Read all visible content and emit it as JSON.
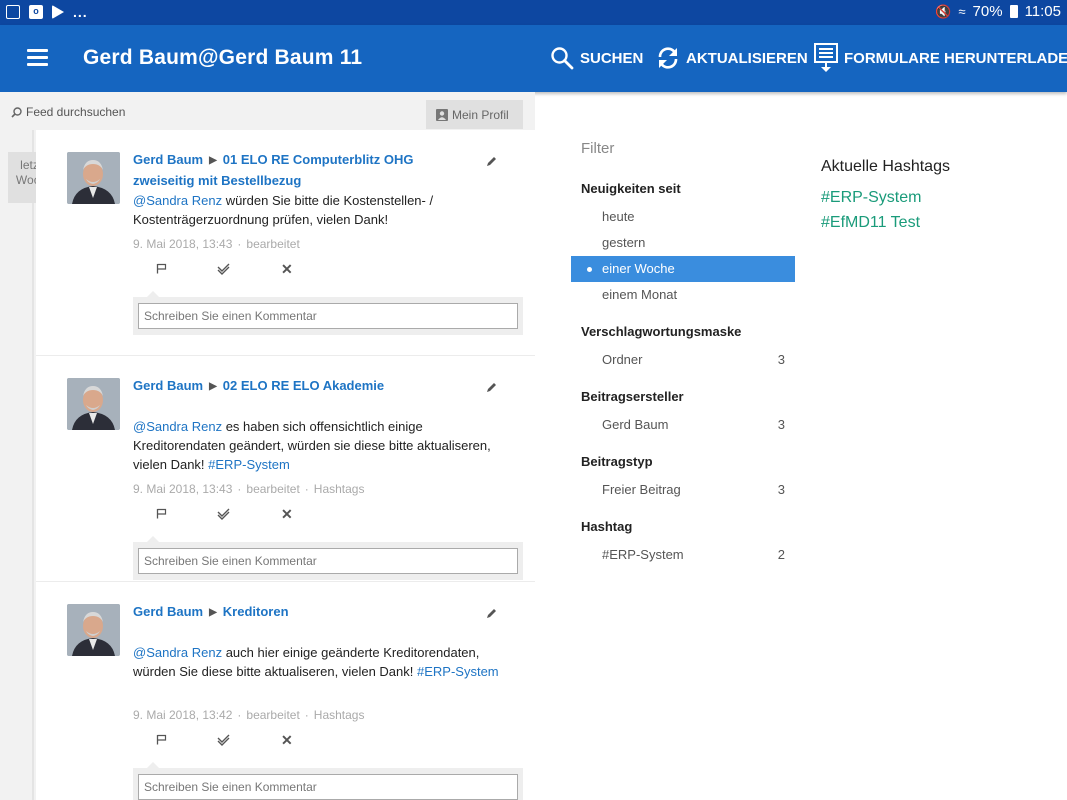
{
  "statusbar": {
    "dots": "...",
    "battery": "70%",
    "time": "11:05"
  },
  "appbar": {
    "title": "Gerd Baum@Gerd Baum 11",
    "actions": {
      "search": "SUCHEN",
      "refresh": "AKTUALISIEREN",
      "download": "FORMULARE HERUNTERLADEN"
    }
  },
  "feed": {
    "search_placeholder": "Feed durchsuchen",
    "profile_button": "Mein Profil",
    "week_badge": "letzte Woche",
    "comment_placeholder": "Schreiben Sie einen Kommentar",
    "posts": [
      {
        "author": "Gerd Baum",
        "target": "01 ELO RE Computerblitz OHG zweiseitig mit Bestellbezug",
        "mention": "@Sandra Renz",
        "text": " würden Sie bitte die Kostenstellen- / Kostenträgerzuordnung prüfen, vielen Dank!",
        "tag": "",
        "date": "9. Mai 2018, 13:43",
        "edited": "bearbeitet",
        "hashtags_link": ""
      },
      {
        "author": "Gerd Baum",
        "target": "02 ELO RE ELO Akademie",
        "mention": "@Sandra Renz",
        "text": " es haben sich offensichtlich einige Kreditorendaten geändert, würden sie diese bitte aktualiseren, vielen Dank! ",
        "tag": "#ERP-System",
        "date": "9. Mai 2018, 13:43",
        "edited": "bearbeitet",
        "hashtags_link": "Hashtags"
      },
      {
        "author": "Gerd Baum",
        "target": "Kreditoren",
        "mention": "@Sandra Renz",
        "text": " auch hier einige geänderte Kreditorendaten, würden Sie diese bitte aktualiseren, vielen Dank! ",
        "tag": "#ERP-System",
        "date": "9. Mai 2018, 13:42",
        "edited": "bearbeitet",
        "hashtags_link": "Hashtags"
      }
    ]
  },
  "filter": {
    "title": "Filter",
    "groups": [
      {
        "title": "Neuigkeiten seit",
        "items": [
          {
            "label": "heute",
            "count": "",
            "selected": false
          },
          {
            "label": "gestern",
            "count": "",
            "selected": false
          },
          {
            "label": "einer Woche",
            "count": "",
            "selected": true
          },
          {
            "label": "einem Monat",
            "count": "",
            "selected": false
          }
        ]
      },
      {
        "title": "Verschlagwortungsmaske",
        "items": [
          {
            "label": "Ordner",
            "count": "3",
            "selected": false
          }
        ]
      },
      {
        "title": "Beitragsersteller",
        "items": [
          {
            "label": "Gerd Baum",
            "count": "3",
            "selected": false
          }
        ]
      },
      {
        "title": "Beitragstyp",
        "items": [
          {
            "label": "Freier Beitrag",
            "count": "3",
            "selected": false
          }
        ]
      },
      {
        "title": "Hashtag",
        "items": [
          {
            "label": "#ERP-System",
            "count": "2",
            "selected": false
          }
        ]
      }
    ]
  },
  "hashtags": {
    "title": "Aktuelle Hashtags",
    "items": [
      "#ERP-System",
      "#EfMD11 Test"
    ]
  },
  "colors": {
    "statusbar": "#0d47a1",
    "appbar": "#1565c0",
    "link": "#1e74c4",
    "selected": "#3a8dde",
    "hashtag": "#1a9b7a"
  }
}
